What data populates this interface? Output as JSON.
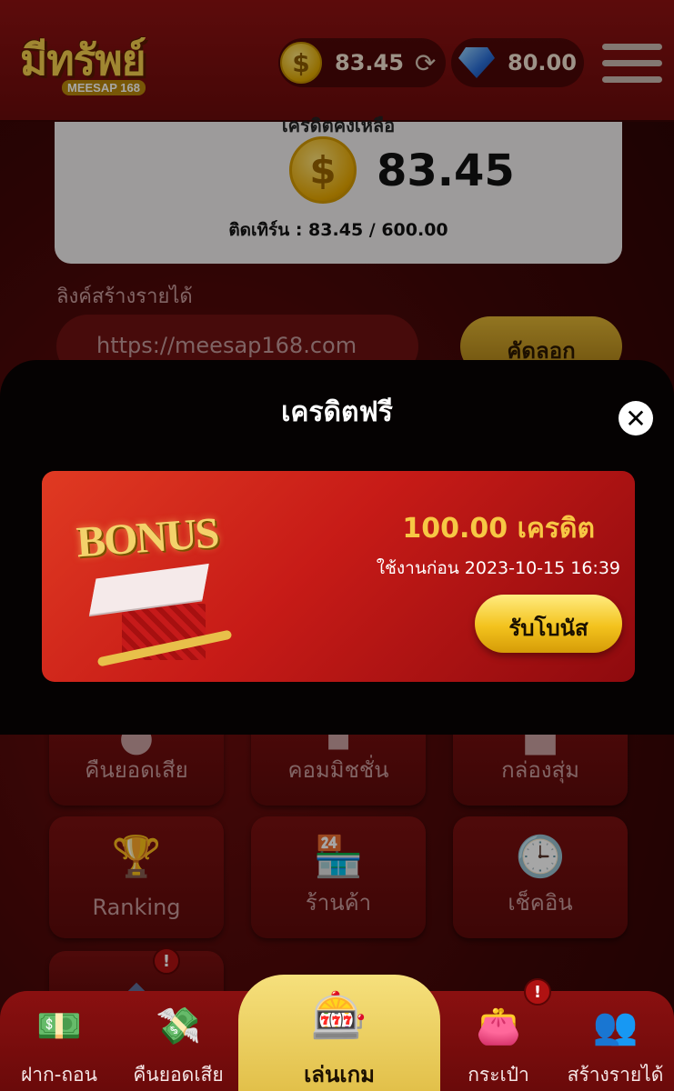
{
  "header": {
    "logo_text": "มีทรัพย์",
    "logo_sub": "MEESAP 168",
    "coin_balance": "83.45",
    "gem_balance": "80.00"
  },
  "credit_card": {
    "label": "เครดิตคงเหลือ",
    "value": "83.45",
    "turnover": "ติดเทิร์น : 83.45 / 600.00"
  },
  "referral": {
    "label": "ลิงค์สร้างรายได้",
    "link": "https://meesap168.com",
    "copy_label": "คัดลอก"
  },
  "menu_tiles": [
    {
      "label": "คืนยอดเสีย",
      "icon": "money-bag-icon"
    },
    {
      "label": "คอมมิชชั่น",
      "icon": "commission-icon"
    },
    {
      "label": "กล่องสุ่ม",
      "icon": "gift-icon"
    },
    {
      "label": "Ranking",
      "icon": "trophy-icon"
    },
    {
      "label": "ร้านค้า",
      "icon": "store-icon"
    },
    {
      "label": "เช็คอิน",
      "icon": "clock-calendar-icon"
    }
  ],
  "modal": {
    "title": "เครดิตฟรี",
    "bonus_image_text": "BONUS",
    "bonus_amount": "100.00 เครดิต",
    "expiry": "ใช้งานก่อน 2023-10-15 16:39",
    "claim_label": "รับโบนัส"
  },
  "bottom_nav": {
    "deposit": "ฝาก-ถอน",
    "cashback": "คืนยอดเสีย",
    "play": "เล่นเกม",
    "wallet": "กระเป๋า",
    "affiliate": "สร้างรายได้",
    "badge": "!"
  },
  "colors": {
    "accent_gold": "#f3c21d",
    "brand_red": "#c71b17",
    "modal_bg": "#050202"
  }
}
